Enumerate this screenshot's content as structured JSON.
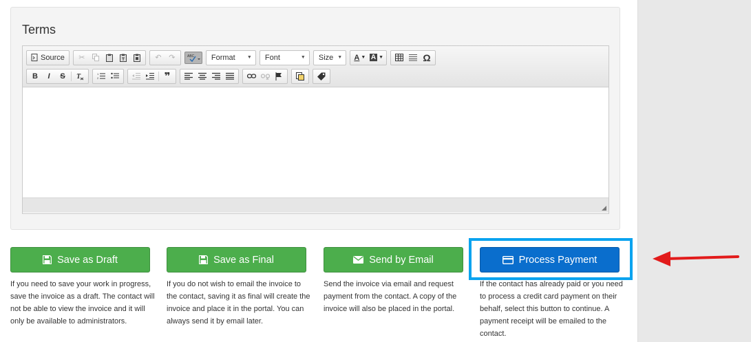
{
  "terms": {
    "title": "Terms"
  },
  "editor": {
    "toolbar": {
      "source_label": "Source",
      "bold_label": "B",
      "italic_label": "I",
      "strike_label": "S",
      "format_combo": "Format",
      "font_combo": "Font",
      "size_combo": "Size",
      "text_color_label": "A",
      "bg_color_label": "A",
      "special_char_label": "Ω"
    },
    "content": ""
  },
  "actions": {
    "save_draft": {
      "label": "Save as Draft",
      "description": "If you need to save your work in progress, save the invoice as a draft. The contact will not be able to view the invoice and it will only be available to administrators."
    },
    "save_final": {
      "label": "Save as Final",
      "description": "If you do not wish to email the invoice to the contact, saving it as final will create the invoice and place it in the portal. You can always send it by email later."
    },
    "send_email": {
      "label": "Send by Email",
      "description": "Send the invoice via email and request payment from the contact. A copy of the invoice will also be placed in the portal."
    },
    "process_payment": {
      "label": "Process Payment",
      "description": "If the contact has already paid or you need to process a credit card payment on their behalf, select this button to continue. A payment receipt will be emailed to the contact."
    }
  },
  "colors": {
    "green_button": "#4cae4c",
    "blue_button": "#0a6ecd",
    "highlight_border": "#0ba3ef",
    "arrow": "#e21b1b"
  }
}
